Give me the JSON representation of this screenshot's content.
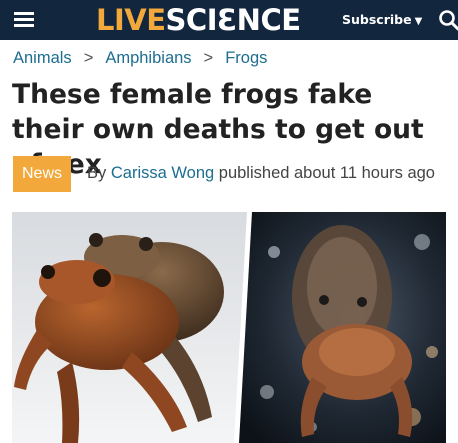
{
  "header": {
    "logo_live": "LIVE",
    "logo_science": "SCIƐNCE",
    "subscribe_label": "Subscribe",
    "menu_icon": "hamburger-menu-icon",
    "search_icon": "search-icon",
    "background_color": "#12263e",
    "accent_color": "#f2a83a"
  },
  "breadcrumb": {
    "items": [
      "Animals",
      "Amphibians",
      "Frogs"
    ],
    "separator": ">"
  },
  "article": {
    "headline": "These female frogs fake their own deaths to get out of sex",
    "category_badge": "News",
    "byline_prefix": "By",
    "author": "Carissa Wong",
    "published": "published about 11 hours ago"
  },
  "link_color": "#1d6e90"
}
